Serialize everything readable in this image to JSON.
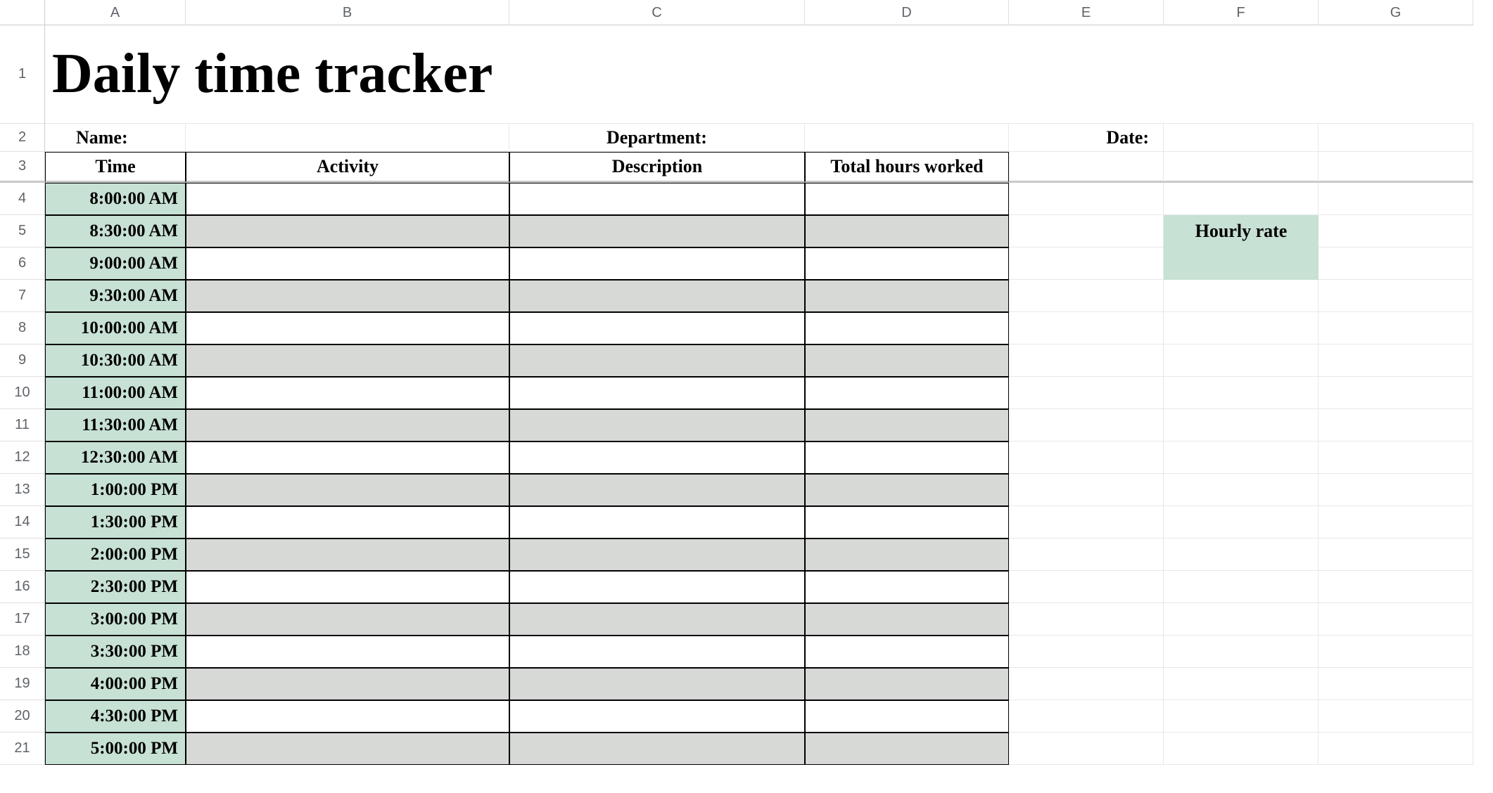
{
  "columns": [
    "A",
    "B",
    "C",
    "D",
    "E",
    "F",
    "G"
  ],
  "row_numbers": [
    1,
    2,
    3,
    4,
    5,
    6,
    7,
    8,
    9,
    10,
    11,
    12,
    13,
    14,
    15,
    16,
    17,
    18,
    19,
    20,
    21
  ],
  "title": "Daily time tracker",
  "labels": {
    "name": "Name:",
    "department": "Department:",
    "date": "Date:",
    "hourly_rate": "Hourly rate"
  },
  "headers": {
    "time": "Time",
    "activity": "Activity",
    "description": "Description",
    "total_hours": "Total hours worked"
  },
  "times": [
    "8:00:00 AM",
    "8:30:00 AM",
    "9:00:00 AM",
    "9:30:00 AM",
    "10:00:00 AM",
    "10:30:00 AM",
    "11:00:00 AM",
    "11:30:00 AM",
    "12:30:00 AM",
    "1:00:00 PM",
    "1:30:00 PM",
    "2:00:00 PM",
    "2:30:00 PM",
    "3:00:00 PM",
    "3:30:00 PM",
    "4:00:00 PM",
    "4:30:00 PM",
    "5:00:00 PM"
  ]
}
